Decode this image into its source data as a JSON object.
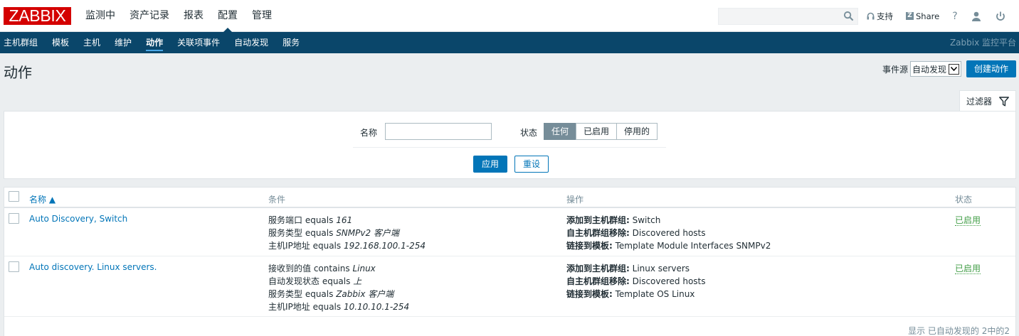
{
  "logo": "ZABBIX",
  "main_menu": [
    "监测中",
    "资产记录",
    "报表",
    "配置",
    "管理"
  ],
  "main_menu_active": "配置",
  "search": {
    "placeholder": ""
  },
  "tools": {
    "support": "支持",
    "share": "Share",
    "help": "?"
  },
  "sub_menu": [
    "主机群组",
    "模板",
    "主机",
    "维护",
    "动作",
    "关联项事件",
    "自动发现",
    "服务"
  ],
  "sub_menu_active": "动作",
  "brand_text": "Zabbix 监控平台",
  "page_title": "动作",
  "event_source": {
    "label": "事件源",
    "value": "自动发现"
  },
  "create_button": "创建动作",
  "filter": {
    "tab_label": "过滤器",
    "name_label": "名称",
    "name_value": "",
    "status_label": "状态",
    "status_options": [
      "任何",
      "已启用",
      "停用的"
    ],
    "status_selected": "任何",
    "apply": "应用",
    "reset": "重设"
  },
  "table": {
    "columns": {
      "name": "名称 ▲",
      "conditions": "条件",
      "operations": "操作",
      "status": "状态"
    },
    "rows": [
      {
        "name": "Auto Discovery, Switch",
        "conditions": [
          {
            "text": "服务端口 equals ",
            "value": "161"
          },
          {
            "text": "服务类型 equals ",
            "value": "SNMPv2 客户端"
          },
          {
            "text": "主机IP地址 equals ",
            "value": "192.168.100.1-254"
          }
        ],
        "operations": [
          {
            "key": "添加到主机群组:",
            "value": " Switch"
          },
          {
            "key": "自主机群组移除:",
            "value": " Discovered hosts"
          },
          {
            "key": "链接到模板:",
            "value": " Template Module Interfaces SNMPv2"
          }
        ],
        "status": "已启用"
      },
      {
        "name": "Auto discovery. Linux servers.",
        "conditions": [
          {
            "text": "接收到的值 contains ",
            "value": "Linux"
          },
          {
            "text": "自动发现状态 equals ",
            "value": "上"
          },
          {
            "text": "服务类型 equals ",
            "value": "Zabbix 客户端"
          },
          {
            "text": "主机IP地址 equals ",
            "value": "10.10.10.1-254"
          }
        ],
        "operations": [
          {
            "key": "添加到主机群组:",
            "value": " Linux servers"
          },
          {
            "key": "自主机群组移除:",
            "value": " Discovered hosts"
          },
          {
            "key": "链接到模板:",
            "value": " Template OS Linux"
          }
        ],
        "status": "已启用"
      }
    ],
    "footer": "显示 已自动发现的 2中的2"
  }
}
